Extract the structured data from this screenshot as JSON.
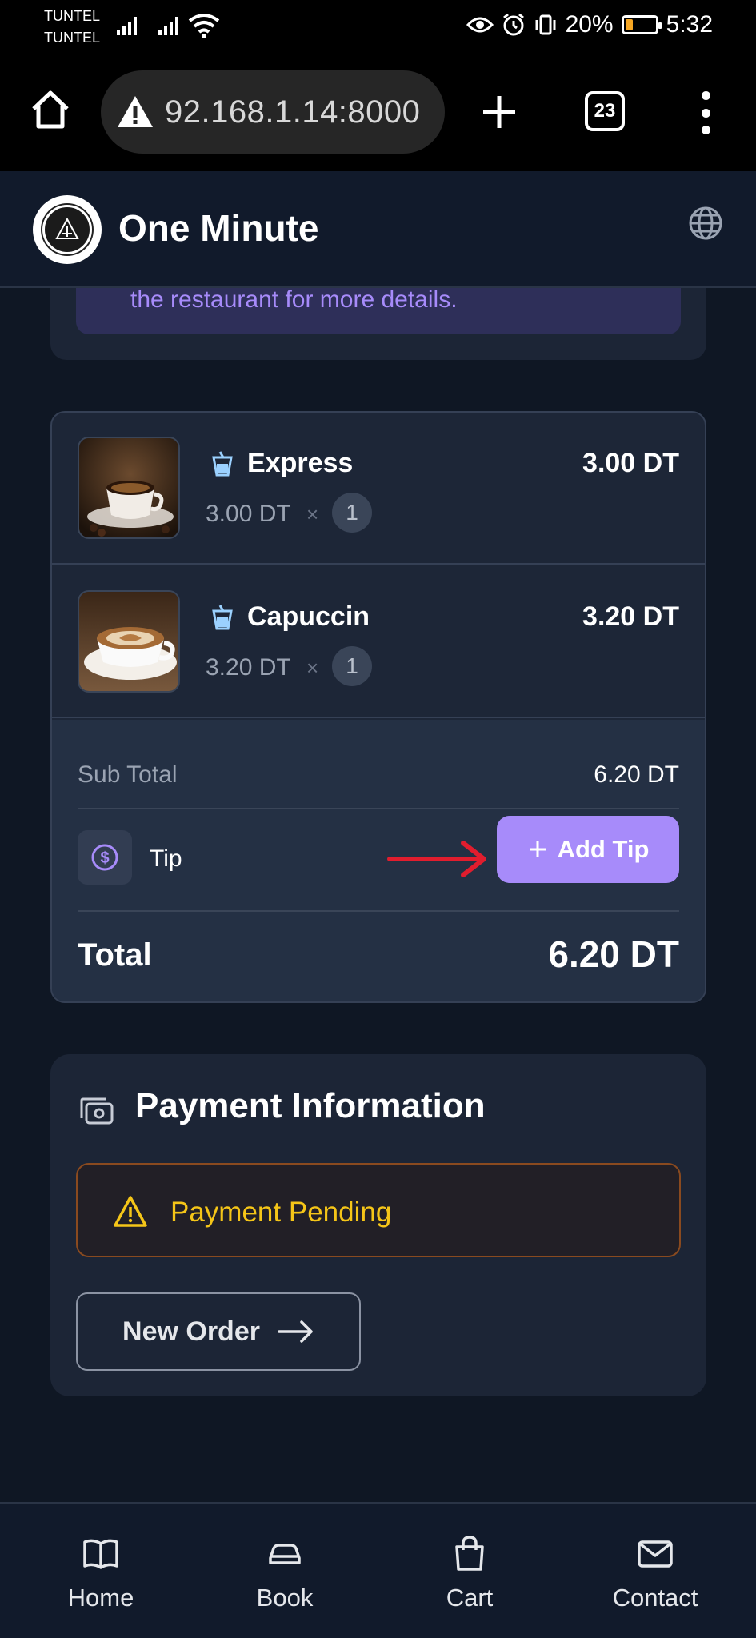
{
  "status_bar": {
    "carrier_1": "TUNTEL",
    "carrier_2": "TUNTEL",
    "battery": "20%",
    "time": "5:32",
    "icons": [
      "signal-icon",
      "wifi-icon",
      "eye-icon",
      "alarm-icon",
      "vibrate-icon",
      "battery-icon"
    ]
  },
  "browser": {
    "url": "92.168.1.14:8000",
    "tab_count": "23",
    "icons": [
      "home-icon",
      "warning-icon",
      "plus-icon",
      "tabs-icon",
      "more-icon"
    ]
  },
  "header": {
    "title": "One Minute",
    "icons": [
      "logo",
      "globe-icon"
    ]
  },
  "notice": {
    "text": "the restaurant for more details."
  },
  "order": {
    "items": [
      {
        "name": "Express",
        "total": "3.00 DT",
        "unit_price": "3.00 DT",
        "times": "×",
        "qty": "1",
        "icon": "drink-icon"
      },
      {
        "name": "Capuccin",
        "total": "3.20 DT",
        "unit_price": "3.20 DT",
        "times": "×",
        "qty": "1",
        "icon": "drink-icon"
      }
    ],
    "subtotal_label": "Sub Total",
    "subtotal_value": "6.20 DT",
    "tip_label": "Tip",
    "add_tip_label": "Add Tip",
    "total_label": "Total",
    "total_value": "6.20 DT"
  },
  "payment": {
    "title": "Payment Information",
    "status": "Payment Pending",
    "new_order_label": "New Order"
  },
  "nav": {
    "items": [
      {
        "label": "Home",
        "icon": "book-open-icon"
      },
      {
        "label": "Book",
        "icon": "car-icon"
      },
      {
        "label": "Cart",
        "icon": "shopping-bag-icon"
      },
      {
        "label": "Contact",
        "icon": "mail-icon"
      }
    ]
  },
  "colors": {
    "background": "#0f1724",
    "accent": "#a78bfa",
    "warning": "#f5c518",
    "annotation_arrow": "#e11d2e"
  }
}
